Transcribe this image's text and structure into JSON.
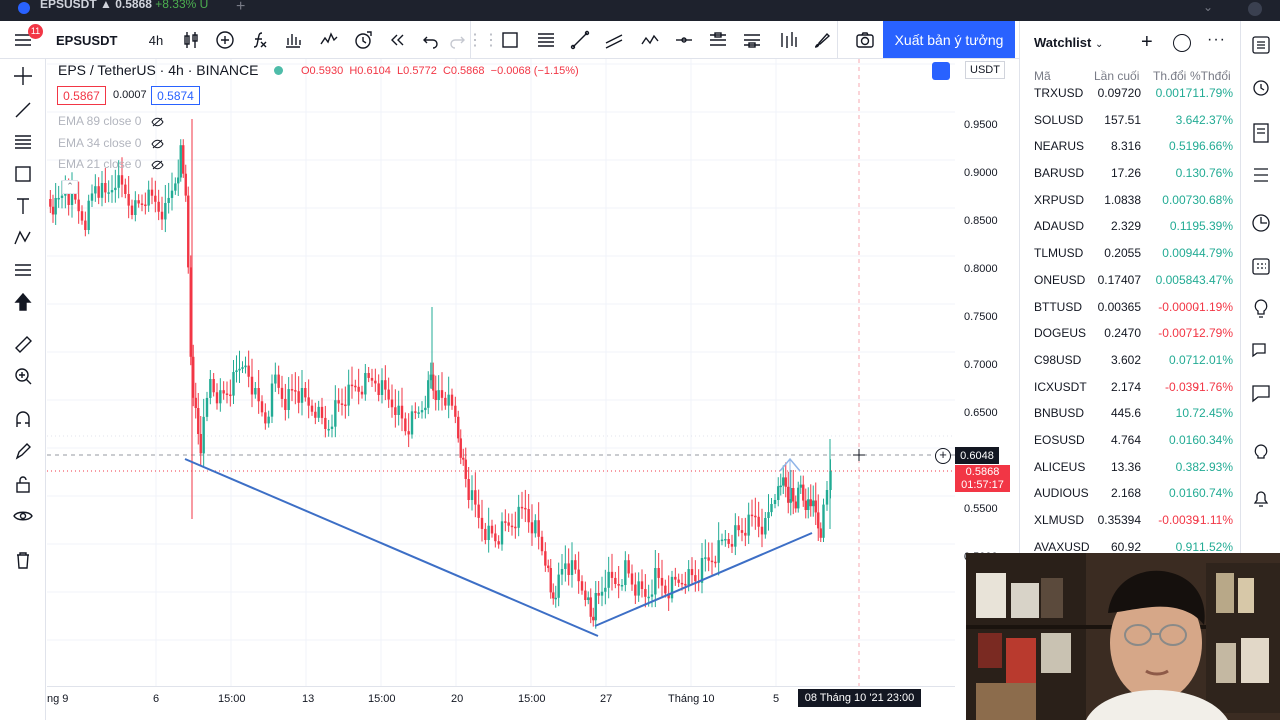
{
  "browser_tab": {
    "title": "EPSUSDT",
    "price": "0.5868",
    "change": "+8.33% U"
  },
  "toolbar": {
    "symbol": "EPSUSDT",
    "interval": "4h",
    "publish_label": "Xuất bản ý tưởng",
    "menu_badge": "11"
  },
  "legend": {
    "title": "EPS / TetherUS · 4h · BINANCE",
    "open": "O0.5930",
    "high": "H0.6104",
    "low": "L0.5772",
    "close": "C0.5868",
    "change": "−0.0068 (−1.15%)",
    "bid": "0.5867",
    "spread": "0.0007",
    "ask": "0.5874",
    "ema": [
      "EMA 89 close 0",
      "EMA 34 close 0",
      "EMA 21 close 0"
    ]
  },
  "price_axis": {
    "currency": "USDT",
    "ticks": [
      "0.9500",
      "0.9000",
      "0.8500",
      "0.8000",
      "0.7500",
      "0.7000",
      "0.6500",
      "0.6000",
      "0.5500",
      "0.5000"
    ],
    "crosshair_price": "0.6048",
    "current_price": "0.5868",
    "countdown": "01:57:17"
  },
  "time_axis": {
    "ticks": [
      "ng 9",
      "6",
      "15:00",
      "13",
      "15:00",
      "20",
      "15:00",
      "27",
      "Tháng 10",
      "5"
    ],
    "crosshair_time": "08 Tháng 10 '21   23:00"
  },
  "watchlist": {
    "title": "Watchlist",
    "columns": [
      "Mã",
      "Lần cuối",
      "Th.đổi",
      "%Thđổi"
    ],
    "rows": [
      {
        "sym": "TRXUSD",
        "last": "0.09720",
        "chg": "0.00171",
        "pct": "1.79%",
        "dir": "up"
      },
      {
        "sym": "SOLUSD",
        "last": "157.51",
        "chg": "3.64",
        "pct": "2.37%",
        "dir": "up"
      },
      {
        "sym": "NEARUS",
        "last": "8.316",
        "chg": "0.519",
        "pct": "6.66%",
        "dir": "up"
      },
      {
        "sym": "BARUSD",
        "last": "17.26",
        "chg": "0.13",
        "pct": "0.76%",
        "dir": "up"
      },
      {
        "sym": "XRPUSD",
        "last": "1.0838",
        "chg": "0.0073",
        "pct": "0.68%",
        "dir": "up"
      },
      {
        "sym": "ADAUSD",
        "last": "2.329",
        "chg": "0.119",
        "pct": "5.39%",
        "dir": "up"
      },
      {
        "sym": "TLMUSD",
        "last": "0.2055",
        "chg": "0.0094",
        "pct": "4.79%",
        "dir": "up"
      },
      {
        "sym": "ONEUSD",
        "last": "0.17407",
        "chg": "0.00584",
        "pct": "3.47%",
        "dir": "up"
      },
      {
        "sym": "BTTUSD",
        "last": "0.00365",
        "chg": "-0.0000",
        "pct": "-1.19%",
        "dir": "dn"
      },
      {
        "sym": "DOGEUS",
        "last": "0.2470",
        "chg": "-0.0071",
        "pct": "-2.79%",
        "dir": "dn"
      },
      {
        "sym": "C98USD",
        "last": "3.602",
        "chg": "0.071",
        "pct": "2.01%",
        "dir": "up"
      },
      {
        "sym": "ICXUSDT",
        "last": "2.174",
        "chg": "-0.039",
        "pct": "-1.76%",
        "dir": "dn"
      },
      {
        "sym": "BNBUSD",
        "last": "445.6",
        "chg": "10.7",
        "pct": "2.45%",
        "dir": "up"
      },
      {
        "sym": "EOSUSD",
        "last": "4.764",
        "chg": "0.016",
        "pct": "0.34%",
        "dir": "up"
      },
      {
        "sym": "ALICEUS",
        "last": "13.36",
        "chg": "0.38",
        "pct": "2.93%",
        "dir": "up"
      },
      {
        "sym": "AUDIOUS",
        "last": "2.168",
        "chg": "0.016",
        "pct": "0.74%",
        "dir": "up"
      },
      {
        "sym": "XLMUSD",
        "last": "0.35394",
        "chg": "-0.0039",
        "pct": "-1.11%",
        "dir": "dn"
      },
      {
        "sym": "AVAXUSD",
        "last": "60.92",
        "chg": "0.91",
        "pct": "1.52%",
        "dir": "up"
      }
    ]
  },
  "colors": {
    "up": "#22ab94",
    "down": "#f23645",
    "accent": "#2962ff",
    "trendline": "#3d6fc6"
  }
}
